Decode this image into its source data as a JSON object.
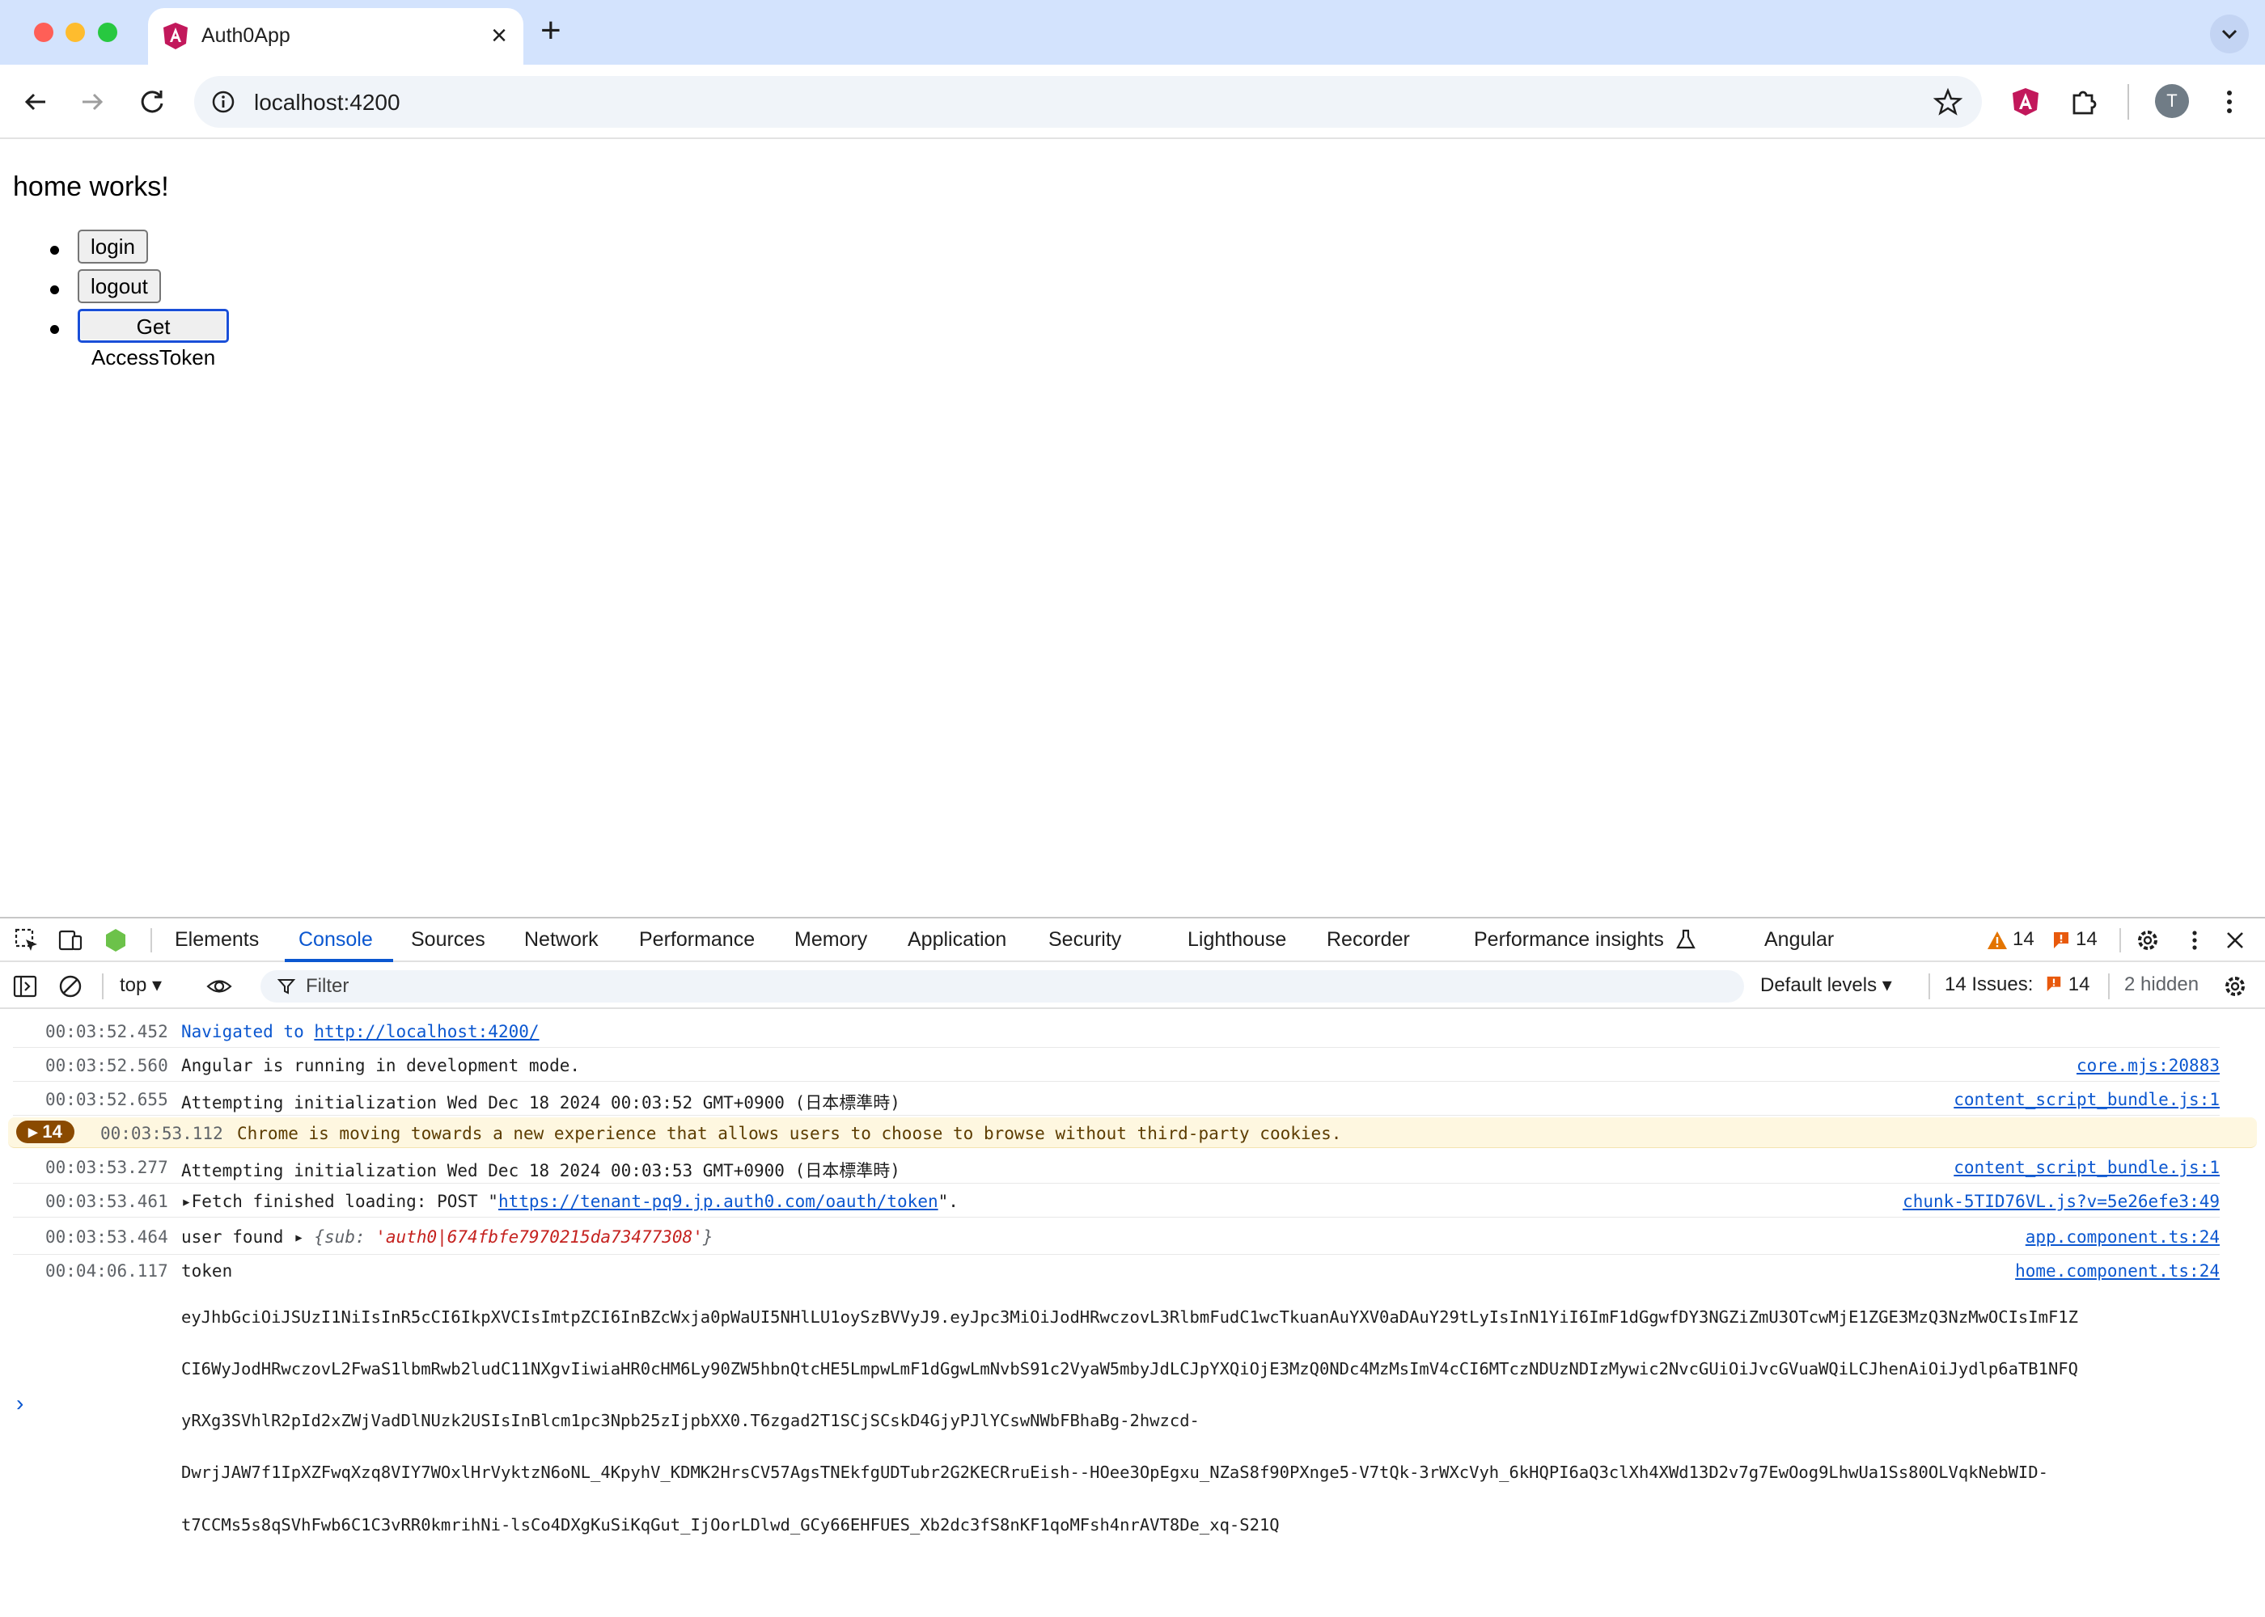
{
  "browser": {
    "tab_title": "Auth0App",
    "new_tab_glyph": "+",
    "close_glyph": "×",
    "url": "localhost:4200",
    "avatar_initial": "T"
  },
  "page": {
    "heading": "home works!",
    "buttons": [
      "login",
      "logout",
      "Get AccessToken"
    ]
  },
  "devtools": {
    "tabs": [
      "Elements",
      "Console",
      "Sources",
      "Network",
      "Performance",
      "Memory",
      "Application",
      "Security",
      "Lighthouse",
      "Recorder",
      "Performance insights",
      "Angular"
    ],
    "active_tab": "Console",
    "warning_count": "14",
    "issue_count": "14",
    "context": "top",
    "filter_placeholder": "Filter",
    "levels": "Default levels",
    "issues_label": "14 Issues:",
    "issues_badge_count": "14",
    "hidden_label": "2 hidden"
  },
  "console": {
    "nav": {
      "ts": "00:03:52.452",
      "prefix": "Navigated to ",
      "link": "http://localhost:4200/"
    },
    "row2": {
      "ts": "00:03:52.560",
      "msg": "Angular is running in development mode.",
      "src": "core.mjs:20883"
    },
    "row3": {
      "ts": "00:03:52.655",
      "msg": "Attempting initialization Wed Dec 18 2024 00:03:52 GMT+0900 (日本標準時)",
      "src": "content_script_bundle.js:1"
    },
    "row4": {
      "badge": "14",
      "ts": "00:03:53.112",
      "msg": "Chrome is moving towards a new experience that allows users to choose to browse without third-party cookies."
    },
    "row5": {
      "ts": "00:03:53.277",
      "msg": "Attempting initialization Wed Dec 18 2024 00:03:53 GMT+0900 (日本標準時)",
      "src": "content_script_bundle.js:1"
    },
    "row6": {
      "ts": "00:03:53.461",
      "prefix": "Fetch finished loading: POST \"",
      "link": "https://tenant-pq9.jp.auth0.com/oauth/token",
      "suffix": "\".",
      "src": "chunk-5TID76VL.js?v=5e26efe3:49"
    },
    "row7": {
      "ts": "00:03:53.464",
      "prefix": "user found ",
      "obj_open": "{",
      "key": "sub",
      "colon": ": ",
      "value": "'auth0|674fbfe7970215da73477308'",
      "obj_close": "}",
      "src": "app.component.ts:24"
    },
    "row8": {
      "ts": "00:04:06.117",
      "label": "token",
      "src": "home.component.ts:24",
      "token_lines": [
        "eyJhbGciOiJSUzI1NiIsInR5cCI6IkpXVCIsImtpZCI6InBZcWxja0pWaUI5NHlLU1oySzBVVyJ9.eyJpc3MiOiJodHRwczovL3RlbmFudC1wcTkuanAuYXV0aDAuY29tLyIsInN1YiI6ImF1dGgwfDY3NGZiZmU3OTcwMjE1ZGE3MzQ3NzMwOCIsImF1Z",
        "CI6WyJodHRwczovL2FwaS1lbmRwb2ludC11NXgvIiwiaHR0cHM6Ly90ZW5hbnQtcHE5LmpwLmF1dGgwLmNvbS91c2VyaW5mbyJdLCJpYXQiOjE3MzQ0NDc4MzMsImV4cCI6MTczNDUzNDIzMywic2NvcGUiOiJvcGVuaWQiLCJhenAiOiJydlp6aTB1NFQ",
        "yRXg3SVhlR2pId2xZWjVadDlNUzk2USIsInBlcm1pc3Npb25zIjpbXX0.T6zgad2T1SCjSCskD4GjyPJlYCswNWbFBhaBg-2hwzcd-",
        "DwrjJAW7f1IpXZFwqXzq8VIY7WOxlHrVyktzN6oNL_4KpyhV_KDMK2HrsCV57AgsTNEkfgUDTubr2G2KECRruEish--HOee3OpEgxu_NZaS8f90PXnge5-V7tQk-3rWXcVyh_6kHQPI6aQ3clXh4XWd13D2v7g7EwOog9LhwUa1Ss80OLVqkNebWID-",
        "t7CCMs5s8qSVhFwb6C1C3vRR0kmrihNi-lsCo4DXgKuSiKqGut_IjOorLDlwd_GCy66EHFUES_Xb2dc3fS8nKF1qoMFsh4nrAVT8De_xq-S21Q"
      ]
    },
    "prompt_glyph": "›"
  },
  "colors": {
    "accent": "#0b57d0",
    "warning_bg": "#fef7e0",
    "focus": "#1a4fd8"
  }
}
